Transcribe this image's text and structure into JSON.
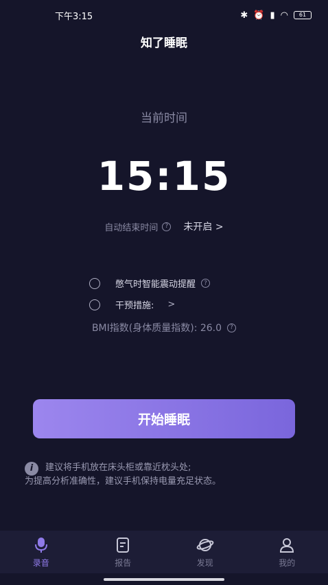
{
  "status_bar": {
    "time": "下午3:15",
    "battery": "61"
  },
  "app": {
    "title": "知了睡眠"
  },
  "clock": {
    "caption": "当前时间",
    "time": "15:15"
  },
  "auto_end": {
    "label": "自动结束时间",
    "value": "未开启 >"
  },
  "options": [
    {
      "label": "憋气时智能震动提醒",
      "checked": false
    },
    {
      "label": "干预措施:",
      "checked": false
    }
  ],
  "bmi": {
    "label": "BMI指数(身体质量指数): 26.0"
  },
  "start_button": {
    "label": "开始睡眠"
  },
  "tips": {
    "lines": [
      "建议将手机放在床头柜或靠近枕头处;",
      "为提高分析准确性，建议手机保持电量充足状态。"
    ]
  },
  "tabs": [
    {
      "label": "录音",
      "icon": "microphone-icon",
      "active": true
    },
    {
      "label": "报告",
      "icon": "report-icon",
      "active": false
    },
    {
      "label": "发现",
      "icon": "planet-icon",
      "active": false
    },
    {
      "label": "我的",
      "icon": "user-icon",
      "active": false
    }
  ],
  "colors": {
    "accent": "#8f7ae8",
    "background": "#15152a",
    "button_start": "#9c86ee",
    "button_end": "#7a66dc"
  }
}
